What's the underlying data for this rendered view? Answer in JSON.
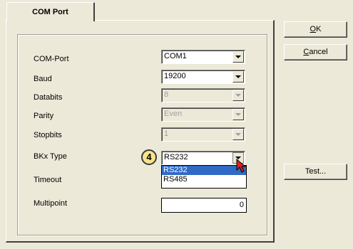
{
  "tab": {
    "label": "COM Port"
  },
  "form": {
    "com_port": {
      "label": "COM-Port",
      "value": "COM1"
    },
    "baud": {
      "label": "Baud",
      "value": "19200"
    },
    "databits": {
      "label": "Databits",
      "value": "8"
    },
    "parity": {
      "label": "Parity",
      "value": "Even"
    },
    "stopbits": {
      "label": "Stopbits",
      "value": "1"
    },
    "bkx_type": {
      "label": "BKx Type",
      "value": "RS232",
      "options": [
        "RS232",
        "RS485"
      ]
    },
    "timeout": {
      "label": "Timeout"
    },
    "multipoint": {
      "label": "Multipoint",
      "value": "0"
    }
  },
  "step_marker": "4",
  "buttons": {
    "ok": {
      "mnemonic": "O",
      "rest": "K"
    },
    "cancel": {
      "mnemonic": "C",
      "rest": "ancel"
    },
    "test": "Test..."
  },
  "colors": {
    "dialog_bg": "#ece9d8",
    "selection": "#316ac5",
    "step_badge": "#f7e38a",
    "cursor": "#e02020"
  }
}
